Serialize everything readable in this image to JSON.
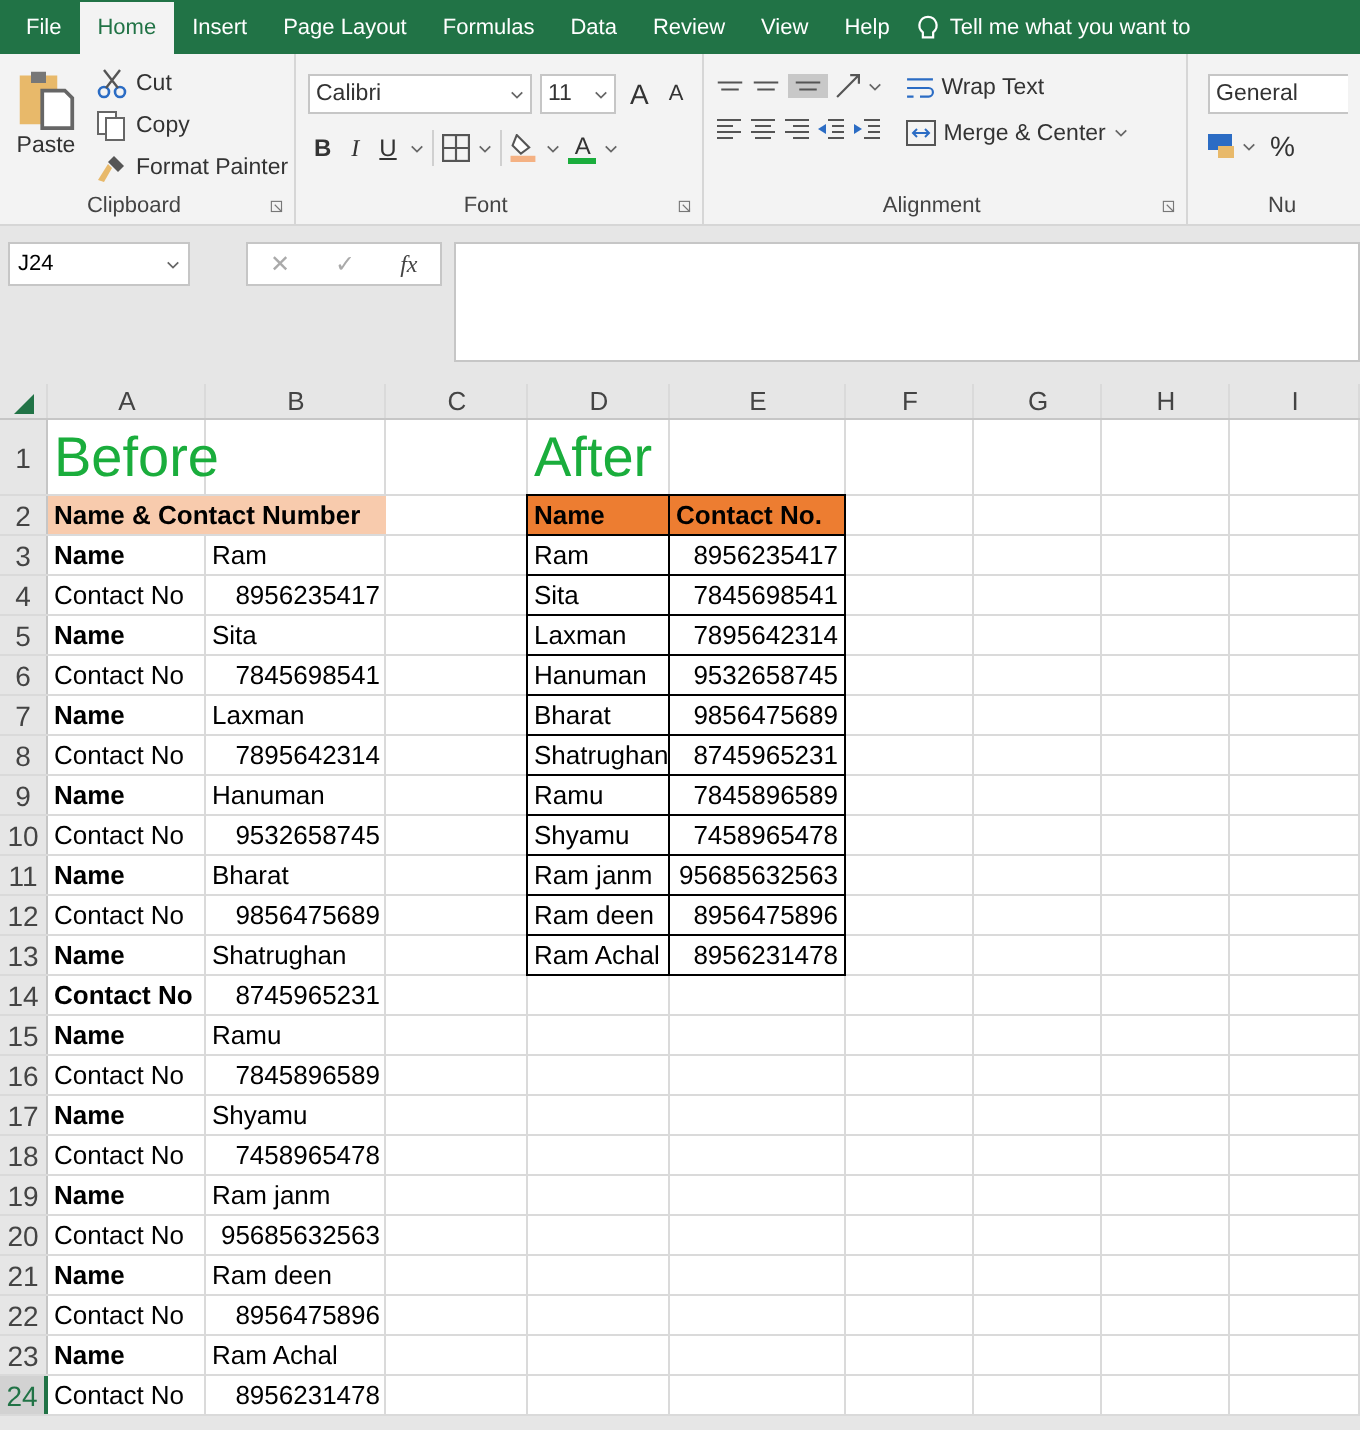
{
  "ribbon": {
    "tabs": [
      {
        "label": "File",
        "selected": false
      },
      {
        "label": "Home",
        "selected": true
      },
      {
        "label": "Insert",
        "selected": false
      },
      {
        "label": "Page Layout",
        "selected": false
      },
      {
        "label": "Formulas",
        "selected": false
      },
      {
        "label": "Data",
        "selected": false
      },
      {
        "label": "Review",
        "selected": false
      },
      {
        "label": "View",
        "selected": false
      },
      {
        "label": "Help",
        "selected": false
      }
    ],
    "tell_me": "Tell me what you want to",
    "clipboard": {
      "paste": "Paste",
      "cut": "Cut",
      "copy": "Copy",
      "format_painter": "Format Painter",
      "label": "Clipboard"
    },
    "font": {
      "name": "Calibri",
      "size": "11",
      "grow": "A",
      "shrink": "A",
      "bold": "B",
      "italic": "I",
      "underline": "U",
      "font_color": "A",
      "label": "Font"
    },
    "alignment": {
      "wrap": "Wrap Text",
      "merge": "Merge & Center",
      "label": "Alignment"
    },
    "number": {
      "format": "General",
      "percent": "%",
      "label": "Nu"
    }
  },
  "formula_bar": {
    "name_box": "J24",
    "cancel": "✕",
    "enter": "✓",
    "function": "fx"
  },
  "sheet": {
    "columns": [
      "A",
      "B",
      "C",
      "D",
      "E",
      "F",
      "G",
      "H",
      "I"
    ],
    "rows": [
      {
        "number": "1",
        "selected": false,
        "cells": [
          {
            "kind": "title",
            "text": "Before"
          },
          {
            "kind": "merged",
            "text": ""
          },
          {
            "kind": "empty",
            "text": ""
          },
          {
            "kind": "title",
            "text": "After"
          },
          {
            "kind": "merged",
            "text": ""
          }
        ]
      },
      {
        "number": "2",
        "selected": false,
        "cells": [
          {
            "kind": "head-light",
            "text": "Name & Contact Number"
          },
          {
            "kind": "merged",
            "text": ""
          },
          {
            "kind": "empty",
            "text": ""
          },
          {
            "kind": "head-dark",
            "text": "Name"
          },
          {
            "kind": "head-dark",
            "text": "Contact No."
          }
        ]
      },
      {
        "number": "3",
        "selected": false,
        "cells": [
          {
            "kind": "label",
            "bold": true,
            "text": "Name"
          },
          {
            "kind": "text",
            "text": "Ram"
          },
          {
            "kind": "empty",
            "text": ""
          },
          {
            "kind": "list-text",
            "text": "Ram"
          },
          {
            "kind": "list-number",
            "text": "8956235417"
          }
        ]
      },
      {
        "number": "4",
        "selected": false,
        "cells": [
          {
            "kind": "label",
            "bold": false,
            "text": "Contact No"
          },
          {
            "kind": "number",
            "text": "8956235417"
          },
          {
            "kind": "empty",
            "text": ""
          },
          {
            "kind": "list-text",
            "text": "Sita"
          },
          {
            "kind": "list-number",
            "text": "7845698541"
          }
        ]
      },
      {
        "number": "5",
        "selected": false,
        "cells": [
          {
            "kind": "label",
            "bold": true,
            "text": "Name"
          },
          {
            "kind": "text",
            "text": "Sita"
          },
          {
            "kind": "empty",
            "text": ""
          },
          {
            "kind": "list-text",
            "text": "Laxman"
          },
          {
            "kind": "list-number",
            "text": "7895642314"
          }
        ]
      },
      {
        "number": "6",
        "selected": false,
        "cells": [
          {
            "kind": "label",
            "bold": false,
            "text": "Contact No"
          },
          {
            "kind": "number",
            "text": "7845698541"
          },
          {
            "kind": "empty",
            "text": ""
          },
          {
            "kind": "list-text",
            "text": "Hanuman"
          },
          {
            "kind": "list-number",
            "text": "9532658745"
          }
        ]
      },
      {
        "number": "7",
        "selected": false,
        "cells": [
          {
            "kind": "label",
            "bold": true,
            "text": "Name"
          },
          {
            "kind": "text",
            "text": "Laxman"
          },
          {
            "kind": "empty",
            "text": ""
          },
          {
            "kind": "list-text",
            "text": "Bharat"
          },
          {
            "kind": "list-number",
            "text": "9856475689"
          }
        ]
      },
      {
        "number": "8",
        "selected": false,
        "cells": [
          {
            "kind": "label",
            "bold": false,
            "text": "Contact No"
          },
          {
            "kind": "number",
            "text": "7895642314"
          },
          {
            "kind": "empty",
            "text": ""
          },
          {
            "kind": "list-text",
            "text": "Shatrughan"
          },
          {
            "kind": "list-number",
            "text": "8745965231"
          }
        ]
      },
      {
        "number": "9",
        "selected": false,
        "cells": [
          {
            "kind": "label",
            "bold": true,
            "text": "Name"
          },
          {
            "kind": "text",
            "text": "Hanuman"
          },
          {
            "kind": "empty",
            "text": ""
          },
          {
            "kind": "list-text",
            "text": "Ramu"
          },
          {
            "kind": "list-number",
            "text": "7845896589"
          }
        ]
      },
      {
        "number": "10",
        "selected": false,
        "cells": [
          {
            "kind": "label",
            "bold": false,
            "text": "Contact No"
          },
          {
            "kind": "number",
            "text": "9532658745"
          },
          {
            "kind": "empty",
            "text": ""
          },
          {
            "kind": "list-text",
            "text": "Shyamu"
          },
          {
            "kind": "list-number",
            "text": "7458965478"
          }
        ]
      },
      {
        "number": "11",
        "selected": false,
        "cells": [
          {
            "kind": "label",
            "bold": true,
            "text": "Name"
          },
          {
            "kind": "text",
            "text": "Bharat"
          },
          {
            "kind": "empty",
            "text": ""
          },
          {
            "kind": "list-text",
            "text": "Ram janm"
          },
          {
            "kind": "list-number",
            "text": "95685632563"
          }
        ]
      },
      {
        "number": "12",
        "selected": false,
        "cells": [
          {
            "kind": "label",
            "bold": false,
            "text": "Contact No"
          },
          {
            "kind": "number",
            "text": "9856475689"
          },
          {
            "kind": "empty",
            "text": ""
          },
          {
            "kind": "list-text",
            "text": "Ram deen"
          },
          {
            "kind": "list-number",
            "text": "8956475896"
          }
        ]
      },
      {
        "number": "13",
        "selected": false,
        "cells": [
          {
            "kind": "label",
            "bold": true,
            "text": "Name"
          },
          {
            "kind": "text",
            "text": "Shatrughan"
          },
          {
            "kind": "empty",
            "text": ""
          },
          {
            "kind": "list-text",
            "text": "Ram Achal"
          },
          {
            "kind": "list-number",
            "text": "8956231478"
          }
        ]
      },
      {
        "number": "14",
        "selected": false,
        "cells": [
          {
            "kind": "label",
            "bold": true,
            "text": "Contact No"
          },
          {
            "kind": "number",
            "text": "8745965231"
          }
        ]
      },
      {
        "number": "15",
        "selected": false,
        "cells": [
          {
            "kind": "label",
            "bold": true,
            "text": "Name"
          },
          {
            "kind": "text",
            "text": "Ramu"
          }
        ]
      },
      {
        "number": "16",
        "selected": false,
        "cells": [
          {
            "kind": "label",
            "bold": false,
            "text": "Contact No"
          },
          {
            "kind": "number",
            "text": "7845896589"
          }
        ]
      },
      {
        "number": "17",
        "selected": false,
        "cells": [
          {
            "kind": "label",
            "bold": true,
            "text": "Name"
          },
          {
            "kind": "text",
            "text": "Shyamu"
          }
        ]
      },
      {
        "number": "18",
        "selected": false,
        "cells": [
          {
            "kind": "label",
            "bold": false,
            "text": "Contact No"
          },
          {
            "kind": "number",
            "text": "7458965478"
          }
        ]
      },
      {
        "number": "19",
        "selected": false,
        "cells": [
          {
            "kind": "label",
            "bold": true,
            "text": "Name"
          },
          {
            "kind": "text",
            "text": "Ram janm"
          }
        ]
      },
      {
        "number": "20",
        "selected": false,
        "cells": [
          {
            "kind": "label",
            "bold": false,
            "text": "Contact No"
          },
          {
            "kind": "number",
            "text": "95685632563"
          }
        ]
      },
      {
        "number": "21",
        "selected": false,
        "cells": [
          {
            "kind": "label",
            "bold": true,
            "text": "Name"
          },
          {
            "kind": "text",
            "text": "Ram deen"
          }
        ]
      },
      {
        "number": "22",
        "selected": false,
        "cells": [
          {
            "kind": "label",
            "bold": false,
            "text": "Contact No"
          },
          {
            "kind": "number",
            "text": "8956475896"
          }
        ]
      },
      {
        "number": "23",
        "selected": false,
        "cells": [
          {
            "kind": "label",
            "bold": true,
            "text": "Name"
          },
          {
            "kind": "text",
            "text": "Ram Achal"
          }
        ]
      },
      {
        "number": "24",
        "selected": true,
        "cells": [
          {
            "kind": "label",
            "bold": false,
            "text": "Contact No"
          },
          {
            "kind": "number",
            "text": "8956231478"
          }
        ]
      }
    ]
  }
}
